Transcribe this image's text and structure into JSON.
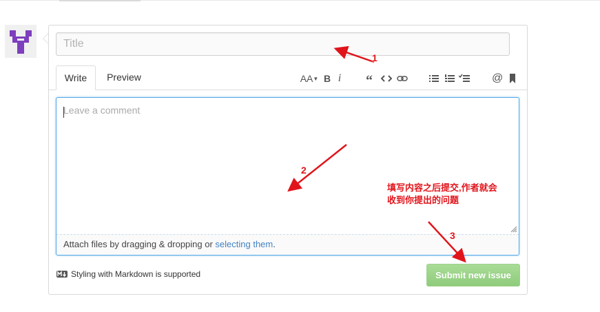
{
  "issue_form": {
    "title_placeholder": "Title",
    "tabs": [
      {
        "label": "Write",
        "active": true
      },
      {
        "label": "Preview",
        "active": false
      }
    ],
    "toolbar": {
      "text_size": "AA",
      "bold": "B",
      "italic": "i",
      "mention": "@",
      "icons": [
        "text-size-icon",
        "bold-icon",
        "italic-icon",
        "quote-icon",
        "code-icon",
        "link-icon",
        "unordered-list-icon",
        "ordered-list-icon",
        "task-list-icon",
        "mention-icon",
        "bookmark-icon"
      ]
    },
    "comment_placeholder": "Leave a comment",
    "attach_text": "Attach files by dragging & dropping or ",
    "attach_link": "selecting them",
    "attach_suffix": ".",
    "markdown_note": "Styling with Markdown is supported",
    "submit_label": "Submit new issue"
  },
  "annotations": {
    "numbers": [
      "1",
      "2",
      "3"
    ],
    "note": "填写内容之后提交,作者就会收到你提出的问题",
    "color": "#e1141b"
  },
  "colors": {
    "submit_bg": "#9fd48c",
    "focus_border": "#51a7e8",
    "link": "#4183c4",
    "avatar": "#7d3fbd"
  }
}
